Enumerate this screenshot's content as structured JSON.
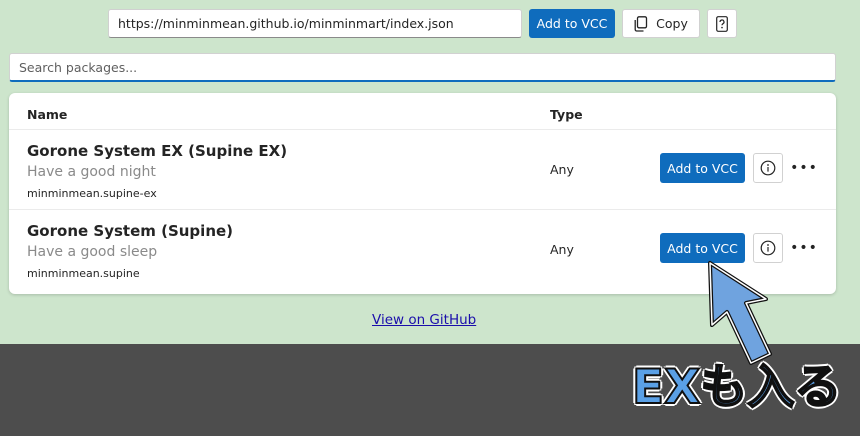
{
  "header": {
    "repo_url": "https://minminmean.github.io/minminmart/index.json",
    "add_vcc_label": "Add to VCC",
    "copy_label": "Copy",
    "copy_icon": "copy-icon",
    "help_icon": "question-icon"
  },
  "search": {
    "placeholder": "Search packages..."
  },
  "table": {
    "headers": {
      "name": "Name",
      "type": "Type"
    },
    "rows": [
      {
        "title": "Gorone System EX (Supine EX)",
        "description": "Have a good night",
        "id": "minminmean.supine-ex",
        "type": "Any",
        "add_label": "Add to VCC"
      },
      {
        "title": "Gorone System (Supine)",
        "description": "Have a good sleep",
        "id": "minminmean.supine",
        "type": "Any",
        "add_label": "Add to VCC"
      }
    ]
  },
  "footer": {
    "github_link": "View on GitHub"
  },
  "annotation": {
    "text": "EXも入る",
    "fill_color": "#5aa0e6",
    "arrow_color": "#6fa3df"
  },
  "colors": {
    "accent": "#0f6cbd",
    "page_bg": "#cde5cc",
    "lower_bg": "#4d4d4d"
  }
}
